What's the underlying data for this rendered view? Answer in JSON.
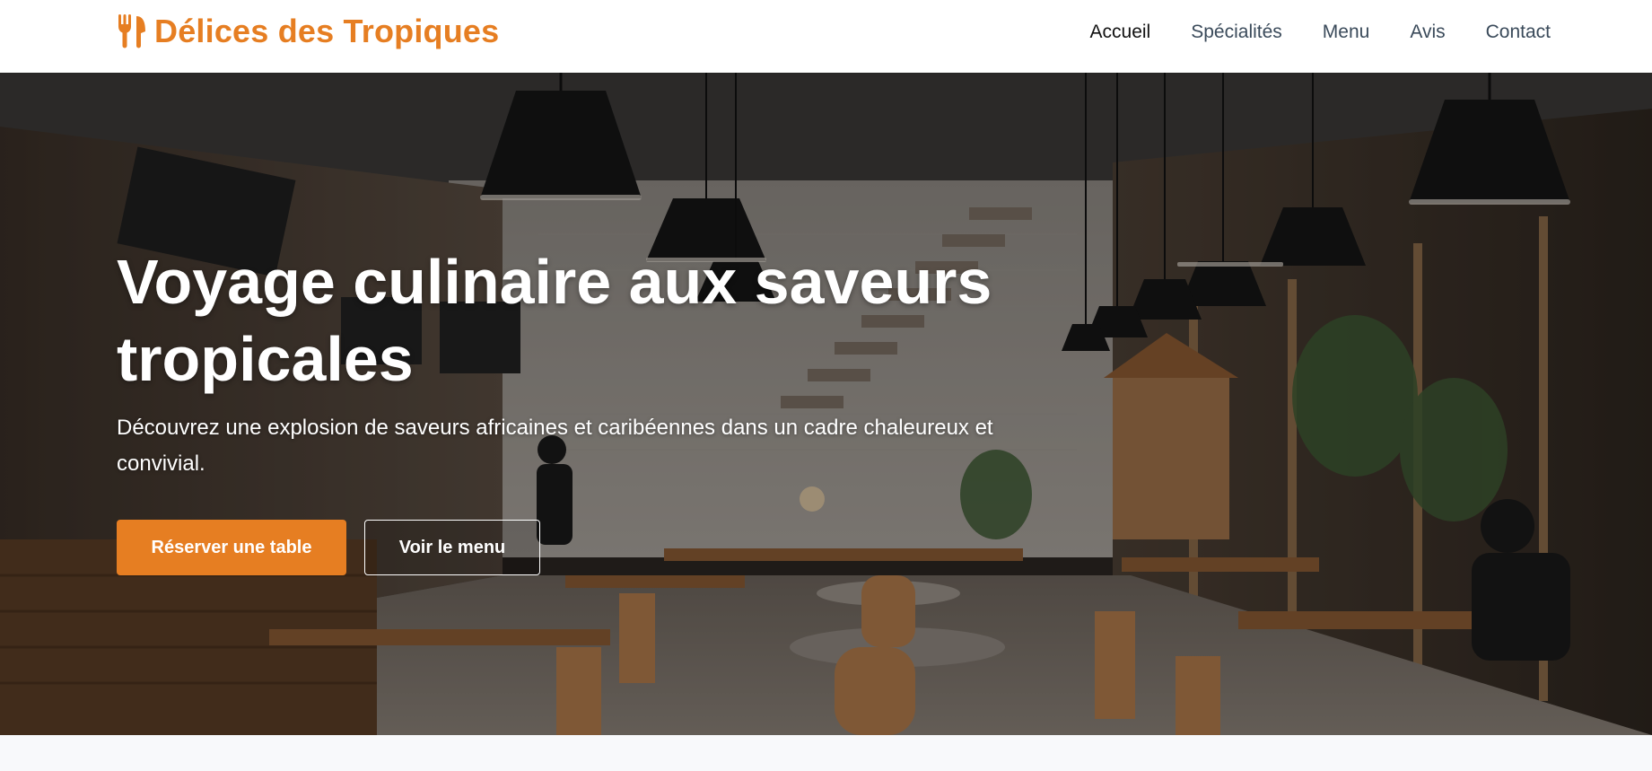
{
  "brand": {
    "name": "Délices des Tropiques",
    "icon": "utensils-icon",
    "color": "#e67e22"
  },
  "nav": {
    "items": [
      {
        "label": "Accueil",
        "active": true
      },
      {
        "label": "Spécialités",
        "active": false
      },
      {
        "label": "Menu",
        "active": false
      },
      {
        "label": "Avis",
        "active": false
      },
      {
        "label": "Contact",
        "active": false
      }
    ]
  },
  "hero": {
    "title": "Voyage culinaire aux saveurs tropicales",
    "subtitle": "Découvrez une explosion de saveurs africaines et caribéennes dans un cadre chaleureux et convivial.",
    "primary_button": "Réserver une table",
    "secondary_button": "Voir le menu",
    "background": "restaurant-interior-image"
  }
}
